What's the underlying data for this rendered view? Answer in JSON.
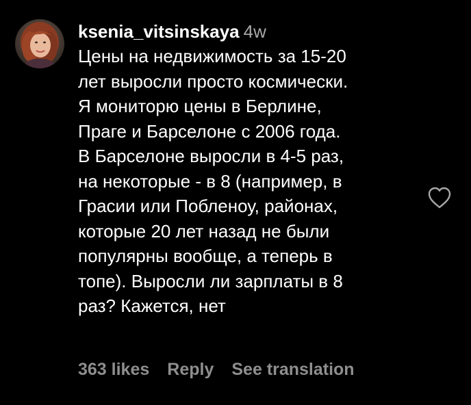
{
  "comment": {
    "username": "ksenia_vitsinskaya",
    "timestamp": "4w",
    "text": "Цены на недвижимость за 15-20\nлет выросли просто космически.\nЯ мониторю цены в Берлине,\nПраге и Барселоне с 2006 года.\nВ Барселоне выросли в 4-5 раз,\nна некоторые - в 8 (например, в\nГрасии или Побленоу, районах,\nкоторые 20 лет назад не были\nпопулярны вообще, а теперь в\nтопе). Выросли ли зарплаты в 8\nраз? Кажется, нет",
    "avatar_icon": "user-avatar-photo",
    "like_icon": "heart-outline-icon"
  },
  "actions": {
    "likes_label": "363 likes",
    "reply_label": "Reply",
    "translate_label": "See translation"
  },
  "colors": {
    "background": "#000000",
    "primary_text": "#ffffff",
    "secondary_text": "#a8a8a8",
    "action_text": "#8e8e8e"
  }
}
